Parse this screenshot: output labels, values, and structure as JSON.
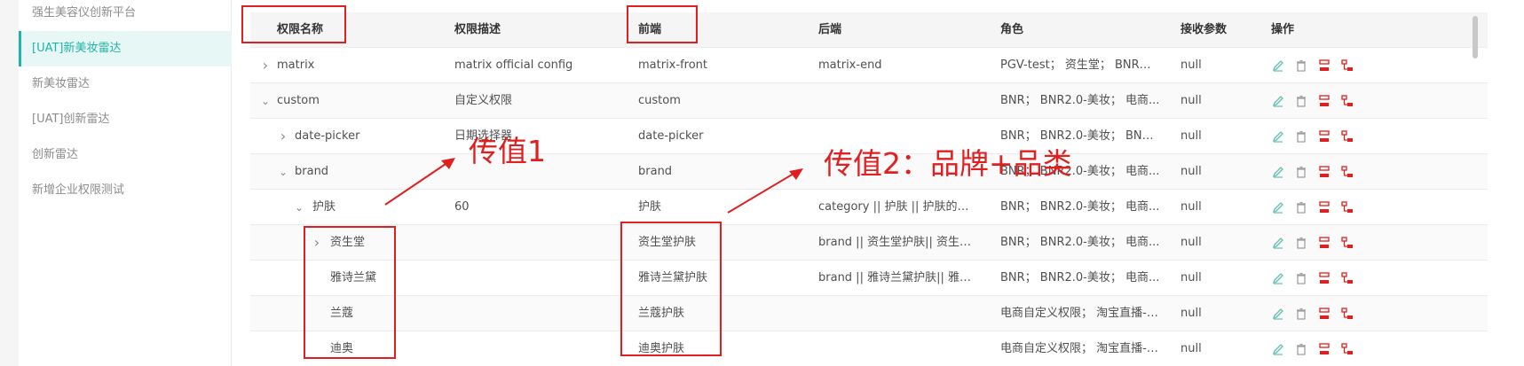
{
  "sidebar": {
    "items": [
      {
        "label": "强生美容仪创新平台"
      },
      {
        "label": "[UAT]新美妆雷达",
        "active": true
      },
      {
        "label": "新美妆雷达"
      },
      {
        "label": "[UAT]创新雷达"
      },
      {
        "label": "创新雷达"
      },
      {
        "label": "新增企业权限测试"
      }
    ]
  },
  "table": {
    "headers": {
      "name": "权限名称",
      "desc": "权限描述",
      "front": "前端",
      "back": "后端",
      "role": "角色",
      "params": "接收参数",
      "ops": "操作"
    },
    "rows": [
      {
        "name": "matrix",
        "desc": "matrix official config",
        "front": "matrix-front",
        "back": "matrix-end",
        "role": "PGV-test； 资生堂； BNR； ...",
        "params": "null"
      },
      {
        "name": "custom",
        "desc": "自定义权限",
        "front": "custom",
        "back": "",
        "role": "BNR； BNR2.0-美妆； 电商...",
        "params": "null"
      },
      {
        "name": "date-picker",
        "desc": "日期选择器",
        "front": "date-picker",
        "back": "",
        "role": "BNR； BNR2.0-美妆； BNR-...",
        "params": "null"
      },
      {
        "name": "brand",
        "desc": "",
        "front": "brand",
        "back": "",
        "role": "BNR； BNR2.0-美妆； 电商...",
        "params": "null"
      },
      {
        "name": "护肤",
        "desc": "60",
        "front": "护肤",
        "back": "category || 护肤 || 护肤的别名",
        "role": "BNR； BNR2.0-美妆； 电商...",
        "params": "null"
      },
      {
        "name": "资生堂",
        "desc": "",
        "front": "资生堂护肤",
        "back": "brand || 资生堂护肤|| 资生堂 |...",
        "role": "BNR； BNR2.0-美妆； 电商...",
        "params": "null"
      },
      {
        "name": "雅诗兰黛",
        "desc": "",
        "front": "雅诗兰黛护肤",
        "back": "brand || 雅诗兰黛护肤|| 雅诗...",
        "role": "BNR； BNR2.0-美妆； 电商...",
        "params": "null"
      },
      {
        "name": "兰蔻",
        "desc": "",
        "front": "兰蔻护肤",
        "back": "",
        "role": "电商自定义权限； 淘宝直播-t...",
        "params": "null"
      },
      {
        "name": "迪奥",
        "desc": "",
        "front": "迪奥护肤",
        "back": "",
        "role": "电商自定义权限； 淘宝直播-t...",
        "params": "null"
      }
    ]
  },
  "annotations": {
    "label1": "传值1",
    "label2": "传值2：品牌+品类"
  },
  "colors": {
    "accent": "#1fb5a6",
    "annotation": "#e02020",
    "edit_icon": "#5fc2b3",
    "delete_icon": "#9a9a9a",
    "red_icon": "#e02020"
  }
}
